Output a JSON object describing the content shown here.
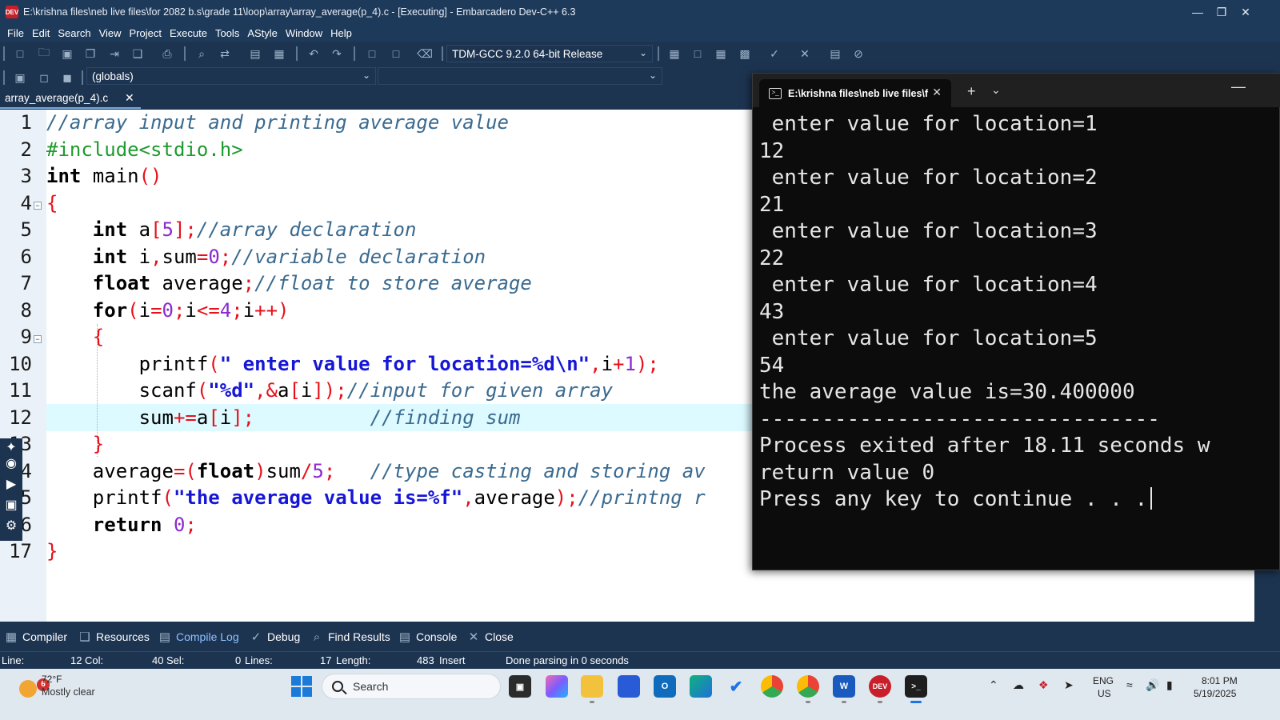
{
  "window": {
    "title": "E:\\krishna files\\neb live files\\for 2082 b.s\\grade 11\\loop\\array\\array_average(p_4).c - [Executing] - Embarcadero Dev-C++ 6.3",
    "app_icon_text": "DEV"
  },
  "menu": [
    "File",
    "Edit",
    "Search",
    "View",
    "Project",
    "Execute",
    "Tools",
    "AStyle",
    "Window",
    "Help"
  ],
  "toolbar": {
    "compiler": "TDM-GCC 9.2.0 64-bit Release",
    "scope": "(globals)"
  },
  "editor": {
    "tab": "array_average(p_4).c",
    "line_numbers": [
      "1",
      "2",
      "3",
      "4",
      "5",
      "6",
      "7",
      "8",
      "9",
      "10",
      "11",
      "12",
      "13",
      "14",
      "15",
      "16",
      "17"
    ],
    "code": [
      [
        {
          "t": "//array input and printing average value",
          "c": "c"
        }
      ],
      [
        {
          "t": "#include<stdio.h>",
          "c": "pp"
        }
      ],
      [
        {
          "t": "int",
          "c": "kw"
        },
        {
          "t": " main"
        },
        {
          "t": "()",
          "c": "p"
        }
      ],
      [
        {
          "t": "{",
          "c": "p"
        }
      ],
      [
        {
          "t": "    "
        },
        {
          "t": "int",
          "c": "kw"
        },
        {
          "t": " a"
        },
        {
          "t": "[",
          "c": "p"
        },
        {
          "t": "5",
          "c": "n"
        },
        {
          "t": "];",
          "c": "p"
        },
        {
          "t": "//array declaration",
          "c": "c"
        }
      ],
      [
        {
          "t": "    "
        },
        {
          "t": "int",
          "c": "kw"
        },
        {
          "t": " i"
        },
        {
          "t": ",",
          "c": "p"
        },
        {
          "t": "sum"
        },
        {
          "t": "=",
          "c": "p"
        },
        {
          "t": "0",
          "c": "n"
        },
        {
          "t": ";",
          "c": "p"
        },
        {
          "t": "//variable declaration",
          "c": "c"
        }
      ],
      [
        {
          "t": "    "
        },
        {
          "t": "float",
          "c": "kw"
        },
        {
          "t": " average"
        },
        {
          "t": ";",
          "c": "p"
        },
        {
          "t": "//float to store average",
          "c": "c"
        }
      ],
      [
        {
          "t": "    "
        },
        {
          "t": "for",
          "c": "kw"
        },
        {
          "t": "(",
          "c": "p"
        },
        {
          "t": "i"
        },
        {
          "t": "=",
          "c": "p"
        },
        {
          "t": "0",
          "c": "n"
        },
        {
          "t": ";",
          "c": "p"
        },
        {
          "t": "i"
        },
        {
          "t": "<=",
          "c": "p"
        },
        {
          "t": "4",
          "c": "n"
        },
        {
          "t": ";",
          "c": "p"
        },
        {
          "t": "i"
        },
        {
          "t": "++)",
          "c": "p"
        }
      ],
      [
        {
          "t": "    "
        },
        {
          "t": "{",
          "c": "p"
        }
      ],
      [
        {
          "t": "        printf"
        },
        {
          "t": "(",
          "c": "p"
        },
        {
          "t": "\" enter value for location=%d\\n\"",
          "c": "s"
        },
        {
          "t": ",",
          "c": "p"
        },
        {
          "t": "i"
        },
        {
          "t": "+",
          "c": "p"
        },
        {
          "t": "1",
          "c": "n"
        },
        {
          "t": ");",
          "c": "p"
        }
      ],
      [
        {
          "t": "        scanf"
        },
        {
          "t": "(",
          "c": "p"
        },
        {
          "t": "\"%d\"",
          "c": "s"
        },
        {
          "t": ",&",
          "c": "p"
        },
        {
          "t": "a"
        },
        {
          "t": "[",
          "c": "p"
        },
        {
          "t": "i"
        },
        {
          "t": "]);",
          "c": "p"
        },
        {
          "t": "//input for given array",
          "c": "c"
        }
      ],
      [
        {
          "t": "        sum"
        },
        {
          "t": "+=",
          "c": "p"
        },
        {
          "t": "a"
        },
        {
          "t": "[",
          "c": "p"
        },
        {
          "t": "i"
        },
        {
          "t": "];",
          "c": "p"
        },
        {
          "t": "          "
        },
        {
          "t": "//finding sum",
          "c": "c"
        }
      ],
      [
        {
          "t": "    "
        },
        {
          "t": "}",
          "c": "p"
        }
      ],
      [
        {
          "t": "    average"
        },
        {
          "t": "=(",
          "c": "p"
        },
        {
          "t": "float",
          "c": "kw"
        },
        {
          "t": ")",
          "c": "p"
        },
        {
          "t": "sum"
        },
        {
          "t": "/",
          "c": "p"
        },
        {
          "t": "5",
          "c": "n"
        },
        {
          "t": ";",
          "c": "p"
        },
        {
          "t": "   "
        },
        {
          "t": "//type casting and storing av",
          "c": "c"
        }
      ],
      [
        {
          "t": "    printf"
        },
        {
          "t": "(",
          "c": "p"
        },
        {
          "t": "\"the average value is=%f\"",
          "c": "s"
        },
        {
          "t": ",",
          "c": "p"
        },
        {
          "t": "average"
        },
        {
          "t": ");",
          "c": "p"
        },
        {
          "t": "//printng r",
          "c": "c"
        }
      ],
      [
        {
          "t": "    "
        },
        {
          "t": "return",
          "c": "kw"
        },
        {
          "t": " "
        },
        {
          "t": "0",
          "c": "n"
        },
        {
          "t": ";",
          "c": "p"
        }
      ],
      [
        {
          "t": "}",
          "c": "p"
        }
      ]
    ]
  },
  "console": {
    "tab_title": "E:\\krishna files\\neb live files\\f",
    "lines": [
      " enter value for location=1",
      "12",
      " enter value for location=2",
      "21",
      " enter value for location=3",
      "22",
      " enter value for location=4",
      "43",
      " enter value for location=5",
      "54",
      "the average value is=30.400000",
      "--------------------------------",
      "Process exited after 18.11 seconds w",
      "return value 0",
      "Press any key to continue . . ."
    ]
  },
  "bottom_tabs": [
    "Compiler",
    "Resources",
    "Compile Log",
    "Debug",
    "Find Results",
    "Console",
    "Close"
  ],
  "status": {
    "line_label": "Line:",
    "line_value": "12",
    "col_label": "Col:",
    "col_value": "40",
    "sel_label": "Sel:",
    "sel_value": "0",
    "lines_label": "Lines:",
    "lines_value": "17",
    "length_label": "Length:",
    "length_value": "483",
    "mode": "Insert",
    "message": "Done parsing in 0 seconds"
  },
  "taskbar": {
    "weather_badge": "6",
    "temperature": "72°F",
    "condition": "Mostly clear",
    "search_label": "Search",
    "lang_top": "ENG",
    "lang_bottom": "US",
    "time": "8:01 PM",
    "date": "5/19/2025",
    "dev_app_label": "DEV"
  },
  "colors": {
    "ide_bg": "#1d3451",
    "editor_bg": "#ffffff",
    "current_line": "#dcfaff",
    "console_bg": "#0c0c0c",
    "taskbar_bg": "#dfe7ef"
  }
}
